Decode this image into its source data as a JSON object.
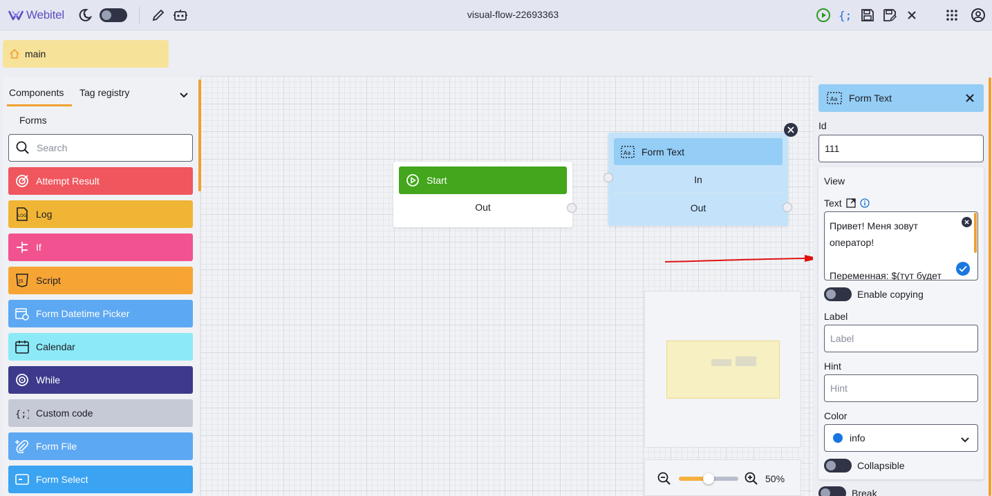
{
  "header": {
    "logo_text": "Webitel",
    "flow_title": "visual-flow-22693363",
    "icons": [
      "moon-icon",
      "pencil-icon",
      "robot-icon",
      "play-icon",
      "code-braces-icon",
      "save-icon",
      "save-as-icon",
      "close-icon",
      "apps-grid-icon",
      "account-icon"
    ]
  },
  "breadcrumb": {
    "label": "main"
  },
  "left_panel": {
    "tabs": [
      "Components",
      "Tag registry"
    ],
    "active_tab": "Components",
    "section": "Forms",
    "search_placeholder": "Search",
    "components": [
      {
        "label": "Attempt Result",
        "icon": "target-icon",
        "color": "#f0565d"
      },
      {
        "label": "Log",
        "icon": "log-icon",
        "color": "#f0b535"
      },
      {
        "label": "If",
        "icon": "branch-icon",
        "color": "#f25290"
      },
      {
        "label": "Script",
        "icon": "js-icon",
        "color": "#f6a535"
      },
      {
        "label": "Form Datetime Picker",
        "icon": "calendar-clock-icon",
        "color": "#5da8f2"
      },
      {
        "label": "Calendar",
        "icon": "calendar-icon",
        "color": "#8ceaf7"
      },
      {
        "label": "While",
        "icon": "loop-icon",
        "color": "#3d3a8c"
      },
      {
        "label": "Custom code",
        "icon": "code-braces-icon",
        "color": "#c6c9d6"
      },
      {
        "label": "Form File",
        "icon": "attachment-icon",
        "color": "#5da8f2"
      },
      {
        "label": "Form Select",
        "icon": "select-icon",
        "color": "#3aa3f2"
      }
    ]
  },
  "canvas": {
    "start_node": {
      "title": "Start",
      "out_label": "Out"
    },
    "form_text_node": {
      "title": "Form Text",
      "in_label": "In",
      "out_label": "Out"
    },
    "zoom": "50%",
    "zoom_fraction": 0.5
  },
  "properties": {
    "title": "Form Text",
    "id_label": "Id",
    "id_value": "111",
    "view_label": "View",
    "text_label": "Text",
    "text_value": "Привет! Меня зовут\nоператор!\n\nПеременная: $(тут будет",
    "enable_copying_label": "Enable copying",
    "label_label": "Label",
    "label_placeholder": "Label",
    "hint_label": "Hint",
    "hint_placeholder": "Hint",
    "color_label": "Color",
    "color_value": "info",
    "collapsible_label": "Collapsible",
    "break_label": "Break"
  },
  "colors": {
    "accent": "#f0a030",
    "start_node": "#43a61c",
    "form_text_node": "#94cdf5",
    "info_dot": "#1976e0"
  }
}
